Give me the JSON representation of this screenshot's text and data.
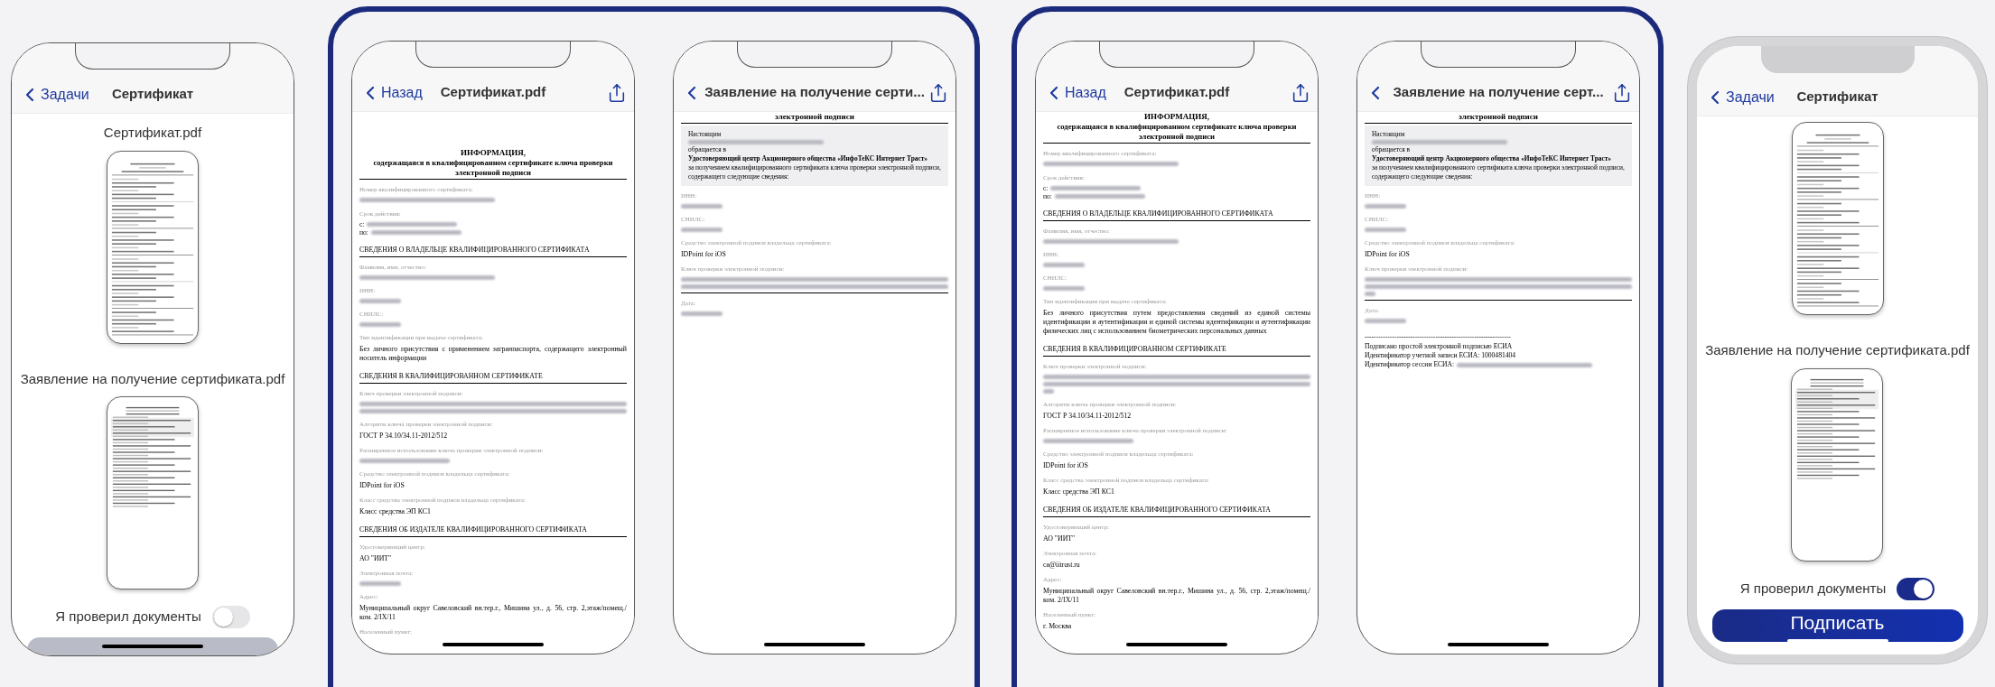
{
  "groups": [
    {
      "framed": false,
      "phones": [
        {
          "kind": "list",
          "bezel": false,
          "nav": {
            "back": "Задачи",
            "title": "Сертификат"
          },
          "documents": [
            {
              "name": "Сертификат.pdf",
              "preview": {
                "kind": "certificate"
              }
            },
            {
              "name": "Заявление на получение сертификата.pdf",
              "preview": {
                "kind": "application"
              }
            }
          ],
          "toggle": {
            "label": "Я проверил документы",
            "on": false
          },
          "button": {
            "disabled": true
          }
        }
      ]
    },
    {
      "framed": true,
      "phones": [
        {
          "kind": "pdf",
          "bezel": false,
          "nav": {
            "back": "Назад",
            "title": "Сертификат.pdf",
            "share": true
          },
          "blocks": [
            {
              "kind": "gap"
            },
            {
              "kind": "title",
              "text": "ИНФОРМАЦИЯ,",
              "subtitle": "содержащаяся в квалифицированном сертификате ключа проверки электронной подписи"
            },
            {
              "kind": "field",
              "label": "Номер квалифицированного сертификата:",
              "blur": {
                "kind": "long"
              }
            },
            {
              "kind": "period",
              "label": "Срок действия:",
              "from": "с:",
              "to": "по:"
            },
            {
              "kind": "heading",
              "text": "СВЕДЕНИЯ О ВЛАДЕЛЬЦЕ КВАЛИФИЦИРОВАННОГО СЕРТИФИКАТА"
            },
            {
              "kind": "field",
              "label": "Фамилия, имя, отчество:",
              "blur": {
                "kind": "long"
              }
            },
            {
              "kind": "field",
              "label": "ИНН:",
              "blur": {
                "kind": "short"
              }
            },
            {
              "kind": "field",
              "label": "СНИЛС:",
              "blur": {
                "kind": "short"
              }
            },
            {
              "kind": "field",
              "label": "Тип идентификации при выдаче сертификата:",
              "value": "Без личного присутствия с применением загранпаспорта, содержащего электронный носитель информации"
            },
            {
              "kind": "heading",
              "text": "СВЕДЕНИЯ В КВАЛИФИЦИРОВАННОМ СЕРТИФИКАТЕ"
            },
            {
              "kind": "field",
              "label": "Ключ проверки электронной подписи:",
              "blur": {
                "kind": "lines2"
              }
            },
            {
              "kind": "field",
              "label": "Алгоритм ключа проверки электронной подписи:",
              "value": "ГОСТ Р 34.10/34.11-2012/512"
            },
            {
              "kind": "field",
              "label": "Расширенное использование ключа проверки электронной подписи:",
              "blur": {
                "kind": "medium"
              }
            },
            {
              "kind": "field",
              "label": "Средство электронной подписи владельца сертификата:",
              "value": "IDPoint for iOS"
            },
            {
              "kind": "field",
              "label": "Класс средства электронной подписи владельца сертификата:",
              "value": "Класс средства ЭП КС1"
            },
            {
              "kind": "heading",
              "text": "СВЕДЕНИЯ ОБ ИЗДАТЕЛЕ КВАЛИФИЦИРОВАННОГО СЕРТИФИКАТА"
            },
            {
              "kind": "field",
              "label": "Удостоверяющий центр:",
              "value": "АО \"ИИТ\""
            },
            {
              "kind": "field",
              "label": "Электронная почта:",
              "blur": {
                "kind": "short"
              }
            },
            {
              "kind": "field",
              "label": "Адрес:",
              "value": "Муниципальный округ Савеловский вн.тер.г., Мишина ул., д. 56, стр. 2,этаж/помещ./ком. 2/IX/11"
            },
            {
              "kind": "field",
              "label": "Населенный пункт:"
            }
          ]
        },
        {
          "kind": "pdf",
          "bezel": false,
          "nav": {
            "title": "Заявление на получение серти...",
            "share": true
          },
          "blocks": [
            {
              "kind": "title",
              "text": "электронной подписи"
            },
            {
              "kind": "box",
              "lines": [
                {
                  "kind": "text",
                  "text": "Настоящим"
                },
                {
                  "kind": "blur"
                },
                {
                  "kind": "text",
                  "text": "обращается в"
                },
                {
                  "kind": "bold",
                  "text": "Удостоверяющий центр Акционерного общества «ИнфоТеКС Интернет Траст»"
                },
                {
                  "kind": "text",
                  "text": "за получением квалифицированного сертификата ключа проверки электронной подписи, содержащего следующие сведения:"
                }
              ]
            },
            {
              "kind": "field",
              "label": "ИНН:",
              "blur": {
                "kind": "short"
              }
            },
            {
              "kind": "field",
              "label": "СНИЛС:",
              "blur": {
                "kind": "short"
              }
            },
            {
              "kind": "field",
              "label": "Средство электронной подписи владельца сертификата:",
              "value": "IDPoint for iOS"
            },
            {
              "kind": "field",
              "label": "Ключ проверки электронной подписи:",
              "blur": {
                "kind": "lines2"
              },
              "rule": true
            },
            {
              "kind": "field",
              "label": "Дата:",
              "blur": {
                "kind": "short"
              }
            }
          ]
        }
      ]
    },
    {
      "framed": true,
      "phones": [
        {
          "kind": "pdf",
          "bezel": false,
          "nav": {
            "back": "Назад",
            "title": "Сертификат.pdf",
            "share": true
          },
          "blocks": [
            {
              "kind": "title",
              "text": "ИНФОРМАЦИЯ,",
              "subtitle": "содержащаяся в квалифицированном сертификате ключа проверки электронной подписи"
            },
            {
              "kind": "field",
              "label": "Номер квалифицированного сертификата:",
              "blur": {
                "kind": "long"
              }
            },
            {
              "kind": "period",
              "label": "Срок действия:",
              "from": "с:",
              "to": "по:"
            },
            {
              "kind": "heading",
              "text": "СВЕДЕНИЯ О ВЛАДЕЛЬЦЕ КВАЛИФИЦИРОВАННОГО СЕРТИФИКАТА"
            },
            {
              "kind": "field",
              "label": "Фамилия, имя, отчество:",
              "blur": {
                "kind": "long"
              }
            },
            {
              "kind": "field",
              "label": "ИНН:",
              "blur": {
                "kind": "short"
              }
            },
            {
              "kind": "field",
              "label": "СНИЛС:",
              "blur": {
                "kind": "short"
              }
            },
            {
              "kind": "field",
              "label": "Тип идентификации при выдаче сертификата:",
              "value": "Без личного присутствия путем предоставления сведений из единой системы идентификации и аутентификации и единой системы идентификации и аутентификации физических лиц с использованием биометрических персональных данных"
            },
            {
              "kind": "heading",
              "text": "СВЕДЕНИЯ В КВАЛИФИЦИРОВАННОМ СЕРТИФИКАТЕ"
            },
            {
              "kind": "field",
              "label": "Ключ проверки электронной подписи:",
              "blur": {
                "kind": "lines3"
              }
            },
            {
              "kind": "field",
              "label": "Алгоритм ключа проверки электронной подписи:",
              "value": "ГОСТ Р 34.10/34.11-2012/512"
            },
            {
              "kind": "field",
              "label": "Расширенное использование ключа проверки электронной подписи:",
              "blur": {
                "kind": "medium"
              }
            },
            {
              "kind": "field",
              "label": "Средство электронной подписи владельца сертификата:",
              "value": "IDPoint for iOS"
            },
            {
              "kind": "field",
              "label": "Класс средства электронной подписи владельца сертификата:",
              "value": "Класс средства ЭП КС1"
            },
            {
              "kind": "heading",
              "text": "СВЕДЕНИЯ ОБ ИЗДАТЕЛЕ КВАЛИФИЦИРОВАННОГО СЕРТИФИКАТА"
            },
            {
              "kind": "field",
              "label": "Удостоверяющий центр:",
              "value": "АО \"ИИТ\""
            },
            {
              "kind": "field",
              "label": "Электронная почта:",
              "value": "ca@iitrust.ru"
            },
            {
              "kind": "field",
              "label": "Адрес:",
              "value": "Муниципальный округ Савеловский вн.тер.г., Мишина ул., д. 56, стр. 2,этаж/помещ./ком. 2/IX/11"
            },
            {
              "kind": "field",
              "label": "Населенный пункт:",
              "value": "г. Москва"
            }
          ]
        },
        {
          "kind": "pdf",
          "bezel": false,
          "nav": {
            "title": "Заявление на получение серт...",
            "share": true
          },
          "blocks": [
            {
              "kind": "title",
              "text": "электронной подписи"
            },
            {
              "kind": "box",
              "lines": [
                {
                  "kind": "text",
                  "text": "Настоящим"
                },
                {
                  "kind": "blur"
                },
                {
                  "kind": "text",
                  "text": "обращается в"
                },
                {
                  "kind": "bold",
                  "text": "Удостоверяющий центр Акционерного общества «ИнфоТеКС Интернет Траст»"
                },
                {
                  "kind": "text",
                  "text": "за получением квалифицированного сертификата ключа проверки электронной подписи, содержащего следующие сведения:"
                }
              ]
            },
            {
              "kind": "field",
              "label": "ИНН:",
              "blur": {
                "kind": "short"
              }
            },
            {
              "kind": "field",
              "label": "СНИЛС:",
              "blur": {
                "kind": "short"
              }
            },
            {
              "kind": "field",
              "label": "Средство электронной подписи владельца сертификата:",
              "value": "IDPoint for iOS"
            },
            {
              "kind": "field",
              "label": "Ключ проверки электронной подписи:",
              "blur": {
                "kind": "lines3"
              },
              "rule": true
            },
            {
              "kind": "field",
              "label": "Дата:",
              "blur": {
                "kind": "short"
              }
            },
            {
              "kind": "signature",
              "lines": [
                {
                  "text": "----------------------------------------------------------------"
                },
                {
                  "text": "Подписано простой электронной подписью ЕСИА"
                },
                {
                  "text": "Идентификатор учетной записи ЕСИА: 1000481404"
                },
                {
                  "text": "Идентификатор сессии ЕСИА:",
                  "blur": {
                    "kind": "long"
                  }
                }
              ]
            }
          ]
        }
      ]
    },
    {
      "framed": false,
      "phones": [
        {
          "kind": "list",
          "bezel": true,
          "nav": {
            "back": "Задачи",
            "title": "Сертификат"
          },
          "documents": [
            {
              "preview": {
                "kind": "certificate"
              }
            },
            {
              "name": "Заявление на получение сертификата.pdf",
              "preview": {
                "kind": "application"
              }
            }
          ],
          "toggle": {
            "label": "Я проверил документы",
            "on": true
          },
          "button": {
            "label": "Подписать",
            "disabled": false
          }
        }
      ]
    }
  ]
}
